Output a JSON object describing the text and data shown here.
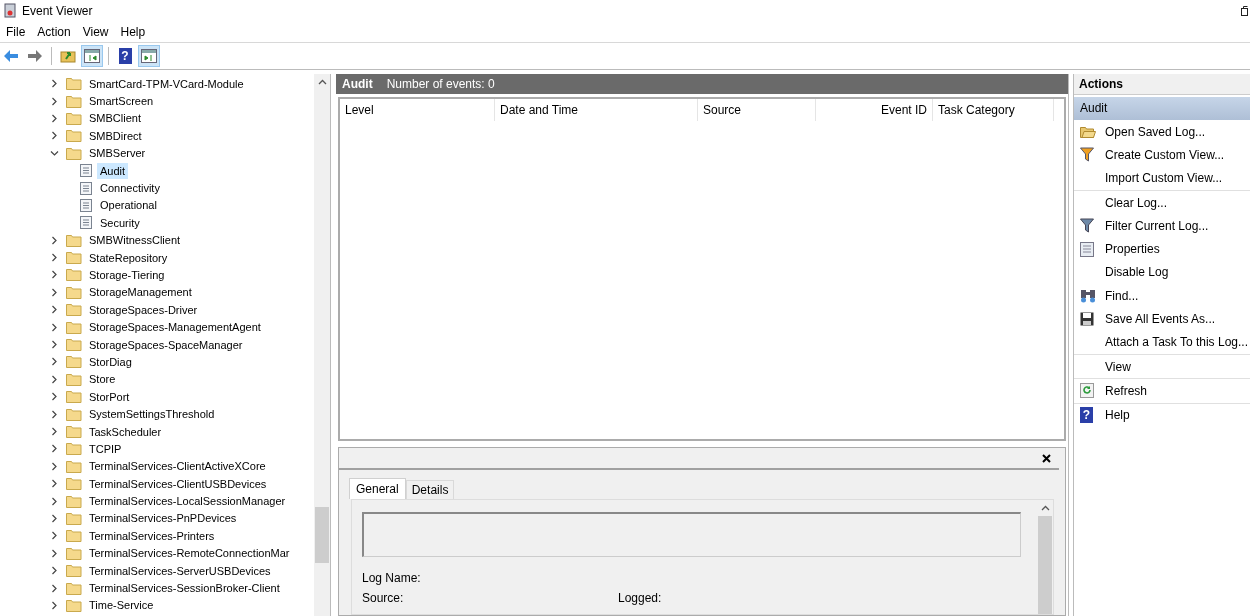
{
  "window": {
    "title": "Event Viewer"
  },
  "menu": [
    "File",
    "Action",
    "View",
    "Help"
  ],
  "toolbar": [
    [
      {
        "kind": "back",
        "pressed": false
      },
      {
        "kind": "forward",
        "pressed": false
      }
    ],
    [
      {
        "kind": "up",
        "pressed": false
      },
      {
        "kind": "tree",
        "pressed": true
      }
    ],
    [
      {
        "kind": "help",
        "pressed": false,
        "glyph": "?"
      },
      {
        "kind": "pane",
        "pressed": true
      }
    ]
  ],
  "tree": [
    {
      "label": "SmartCard-TPM-VCard-Module",
      "expanded": false,
      "selected": false
    },
    {
      "label": "SmartScreen",
      "expanded": false,
      "selected": false
    },
    {
      "label": "SMBClient",
      "expanded": false,
      "selected": false
    },
    {
      "label": "SMBDirect",
      "expanded": false,
      "selected": false
    },
    {
      "label": "SMBServer",
      "expanded": true,
      "selected": false,
      "children": [
        {
          "label": "Audit",
          "selected": true
        },
        {
          "label": "Connectivity",
          "selected": false
        },
        {
          "label": "Operational",
          "selected": false
        },
        {
          "label": "Security",
          "selected": false
        }
      ]
    },
    {
      "label": "SMBWitnessClient",
      "expanded": false,
      "selected": false
    },
    {
      "label": "StateRepository",
      "expanded": false,
      "selected": false
    },
    {
      "label": "Storage-Tiering",
      "expanded": false,
      "selected": false
    },
    {
      "label": "StorageManagement",
      "expanded": false,
      "selected": false
    },
    {
      "label": "StorageSpaces-Driver",
      "expanded": false,
      "selected": false
    },
    {
      "label": "StorageSpaces-ManagementAgent",
      "expanded": false,
      "selected": false
    },
    {
      "label": "StorageSpaces-SpaceManager",
      "expanded": false,
      "selected": false
    },
    {
      "label": "StorDiag",
      "expanded": false,
      "selected": false
    },
    {
      "label": "Store",
      "expanded": false,
      "selected": false
    },
    {
      "label": "StorPort",
      "expanded": false,
      "selected": false
    },
    {
      "label": "SystemSettingsThreshold",
      "expanded": false,
      "selected": false
    },
    {
      "label": "TaskScheduler",
      "expanded": false,
      "selected": false
    },
    {
      "label": "TCPIP",
      "expanded": false,
      "selected": false
    },
    {
      "label": "TerminalServices-ClientActiveXCore",
      "expanded": false,
      "selected": false
    },
    {
      "label": "TerminalServices-ClientUSBDevices",
      "expanded": false,
      "selected": false
    },
    {
      "label": "TerminalServices-LocalSessionManager",
      "expanded": false,
      "selected": false
    },
    {
      "label": "TerminalServices-PnPDevices",
      "expanded": false,
      "selected": false
    },
    {
      "label": "TerminalServices-Printers",
      "expanded": false,
      "selected": false
    },
    {
      "label": "TerminalServices-RemoteConnectionMar",
      "expanded": false,
      "selected": false
    },
    {
      "label": "TerminalServices-ServerUSBDevices",
      "expanded": false,
      "selected": false
    },
    {
      "label": "TerminalServices-SessionBroker-Client",
      "expanded": false,
      "selected": false
    },
    {
      "label": "Time-Service",
      "expanded": false,
      "selected": false
    }
  ],
  "log_header": {
    "name": "Audit",
    "count": "Number of events: 0"
  },
  "table": {
    "columns": [
      "Level",
      "Date and Time",
      "Source",
      "Event ID",
      "Task Category"
    ]
  },
  "detail": {
    "tabs": [
      {
        "label": "General",
        "selected": true
      },
      {
        "label": "Details",
        "selected": false
      }
    ],
    "fields": [
      {
        "label": "Log Name:"
      },
      {
        "label": "Source:"
      },
      {
        "label": "Logged:"
      }
    ]
  },
  "actions": {
    "title": "Actions",
    "section": "Audit",
    "items": [
      {
        "label": "Open Saved Log...",
        "kind": "folder",
        "separator_after": false
      },
      {
        "label": "Create Custom View...",
        "kind": "funnel-color",
        "separator_after": false
      },
      {
        "label": "Import Custom View...",
        "kind": "plain",
        "separator_after": true
      },
      {
        "label": "Clear Log...",
        "kind": "plain",
        "separator_after": false
      },
      {
        "label": "Filter Current Log...",
        "kind": "funnel",
        "separator_after": false
      },
      {
        "label": "Properties",
        "kind": "properties",
        "separator_after": false
      },
      {
        "label": "Disable Log",
        "kind": "plain",
        "separator_after": false
      },
      {
        "label": "Find...",
        "kind": "binoculars",
        "separator_after": false
      },
      {
        "label": "Save All Events As...",
        "kind": "disk",
        "separator_after": false
      },
      {
        "label": "Attach a Task To this Log...",
        "kind": "plain",
        "separator_after": true
      },
      {
        "label": "View",
        "kind": "plain",
        "separator_after": true
      },
      {
        "label": "Refresh",
        "kind": "refresh",
        "separator_after": true
      },
      {
        "label": "Help",
        "kind": "help",
        "glyph": "?",
        "separator_after": false
      }
    ]
  }
}
